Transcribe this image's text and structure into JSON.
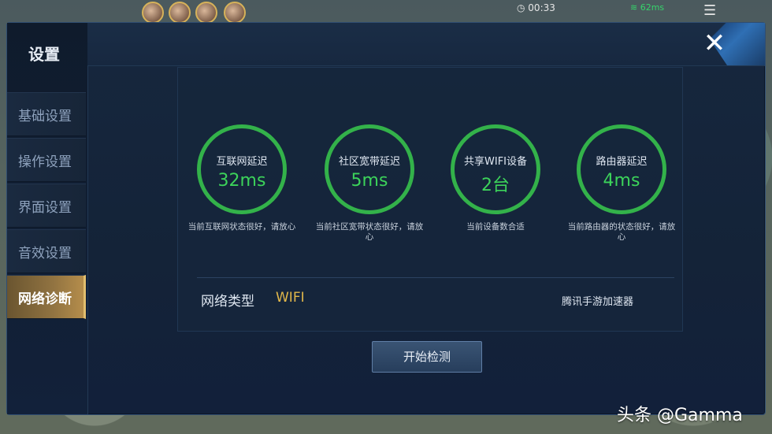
{
  "hud": {
    "time": "00:33",
    "ping": "62ms"
  },
  "dialog": {
    "title": "设置",
    "close_symbol": "✕",
    "sidebar": {
      "items": [
        {
          "label": "基础设置",
          "active": false
        },
        {
          "label": "操作设置",
          "active": false
        },
        {
          "label": "界面设置",
          "active": false
        },
        {
          "label": "音效设置",
          "active": false
        },
        {
          "label": "网络诊断",
          "active": true
        }
      ]
    },
    "gauges": [
      {
        "label": "互联网延迟",
        "value": "32ms",
        "desc": "当前互联网状态很好，请放心"
      },
      {
        "label": "社区宽带延迟",
        "value": "5ms",
        "desc": "当前社区宽带状态很好，请放心"
      },
      {
        "label": "共享WIFI设备",
        "value": "2台",
        "desc": "当前设备数合适"
      },
      {
        "label": "路由器延迟",
        "value": "4ms",
        "desc": "当前路由器的状态很好，请放心"
      }
    ],
    "network_type_label": "网络类型",
    "network_type_value": "WIFI",
    "accelerator_label": "腾讯手游加速器",
    "start_button": "开始检测"
  },
  "watermark": "头条 @Gamma",
  "colors": {
    "accent_green": "#3cd35a",
    "accent_gold": "#e2b84a",
    "active_tab": "#917341"
  }
}
